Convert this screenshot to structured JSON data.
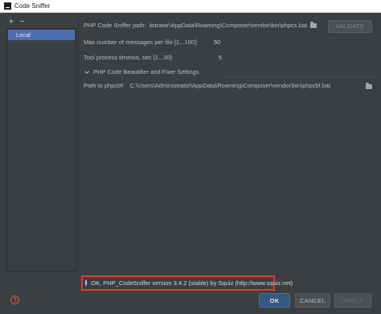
{
  "window": {
    "title": "Code Sniffer"
  },
  "sidebar": {
    "toolbar": {
      "add": "+",
      "remove": "−"
    },
    "items": [
      {
        "label": "Local"
      }
    ]
  },
  "settings": {
    "sniffer_path": {
      "label": "PHP Code Sniffer path:",
      "value": "iistrator\\AppData\\Roaming\\Composer\\vendor\\bin\\phpcs.bat",
      "validate_label": "VALIDATE"
    },
    "max_messages": {
      "label": "Max number of messages per file [1...100]:",
      "value": "50"
    },
    "timeout": {
      "label": "Tool process timeout, sec [1...30]:",
      "value": "5"
    },
    "beautifier": {
      "section_label": "PHP Code Beautifier and Fixer Settings",
      "path_label": "Path to phpcbf:",
      "path_value": "C:\\Users\\Administrator\\AppData\\Roaming\\Composer\\vendor\\bin\\phpcbf.bat"
    }
  },
  "status": {
    "icon": "info-icon",
    "text": "OK, PHP_CodeSniffer version 3.4.2 (stable) by Squiz (http://www.squiz.net)"
  },
  "footer": {
    "help": "?",
    "ok": "OK",
    "cancel": "CANCEL",
    "apply": "APPLY"
  },
  "colors": {
    "background": "#3c3f41",
    "selection": "#4b6eaf",
    "highlight_border": "#e03a2f",
    "primary_button": "#365880"
  }
}
